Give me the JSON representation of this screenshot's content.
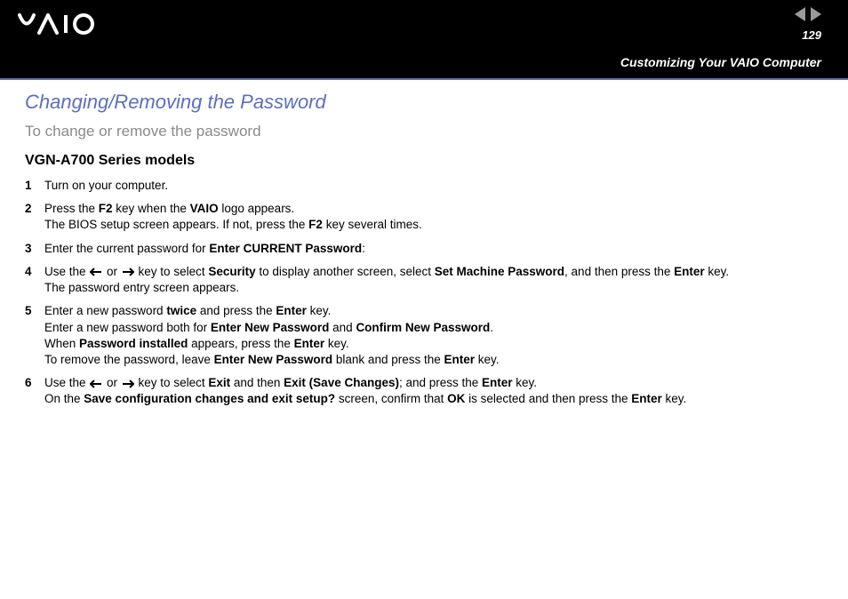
{
  "header": {
    "page_number": "129",
    "subtitle": "Customizing Your VAIO Computer"
  },
  "content": {
    "section_title": "Changing/Removing the Password",
    "section_subtitle": "To change or remove the password",
    "model_title": "VGN-A700 Series models",
    "steps": [
      {
        "num": "1",
        "html": "Turn on your computer."
      },
      {
        "num": "2",
        "html": "Press the <b>F2</b> key when the <b>VAIO</b> logo appears.<br>The BIOS setup screen appears. If not, press the <b>F2</b> key several times."
      },
      {
        "num": "3",
        "html": "Enter the current password for <b>Enter CURRENT Password</b>:"
      },
      {
        "num": "4",
        "html": "Use the <svg class='arrow-left-icon' width='16' height='10'><line x1='2' y1='5' x2='14' y2='5' stroke='#000' stroke-width='2'/><polyline points='6,1 2,5 6,9' fill='none' stroke='#000' stroke-width='2'/></svg> or <svg class='arrow-right-icon' width='16' height='10'><line x1='2' y1='5' x2='14' y2='5' stroke='#000' stroke-width='2'/><polyline points='10,1 14,5 10,9' fill='none' stroke='#000' stroke-width='2'/></svg> key to select <b>Security</b> to display another screen, select <b>Set Machine Password</b>, and then press the <b>Enter</b> key.<br>The password entry screen appears."
      },
      {
        "num": "5",
        "html": "Enter a new password <b>twice</b> and press the <b>Enter</b> key.<br>Enter a new password both for <b>Enter New Password</b> and <b>Confirm New Password</b>.<br>When <b>Password installed</b> appears, press the <b>Enter</b> key.<br>To remove the password, leave <b>Enter New Password</b> blank and press the <b>Enter</b> key."
      },
      {
        "num": "6",
        "html": "Use the <svg class='arrow-left-icon' width='16' height='10'><line x1='2' y1='5' x2='14' y2='5' stroke='#000' stroke-width='2'/><polyline points='6,1 2,5 6,9' fill='none' stroke='#000' stroke-width='2'/></svg> or <svg class='arrow-right-icon' width='16' height='10'><line x1='2' y1='5' x2='14' y2='5' stroke='#000' stroke-width='2'/><polyline points='10,1 14,5 10,9' fill='none' stroke='#000' stroke-width='2'/></svg> key to select <b>Exit</b> and then <b>Exit (Save Changes)</b>; and press the <b>Enter</b> key.<br>On the <b>Save configuration changes and exit setup?</b> screen, confirm that <b>OK</b> is selected and then press the <b>Enter</b> key."
      }
    ]
  }
}
